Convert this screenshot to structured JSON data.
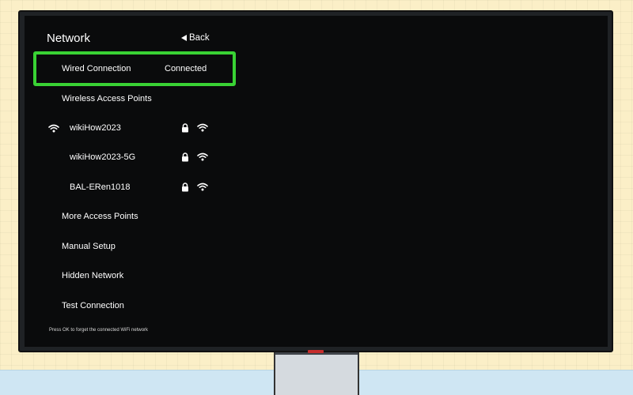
{
  "header": {
    "title": "Network",
    "back_label": "Back"
  },
  "wired": {
    "label": "Wired Connection",
    "status": "Connected"
  },
  "wireless_header": "Wireless Access Points",
  "networks": [
    {
      "name": "wikiHow2023",
      "secured": true,
      "connected": true
    },
    {
      "name": "wikiHow2023-5G",
      "secured": true,
      "connected": false
    },
    {
      "name": "BAL-ERen1018",
      "secured": true,
      "connected": false
    }
  ],
  "menu": {
    "more": "More Access Points",
    "manual": "Manual Setup",
    "hidden": "Hidden Network",
    "test": "Test Connection"
  },
  "footer_hint": "Press OK to forget the connected WiFi network",
  "colors": {
    "highlight": "#39d234",
    "screen": "#0a0b0c",
    "wall": "#fbefc7",
    "floor": "#cfe6f3"
  }
}
